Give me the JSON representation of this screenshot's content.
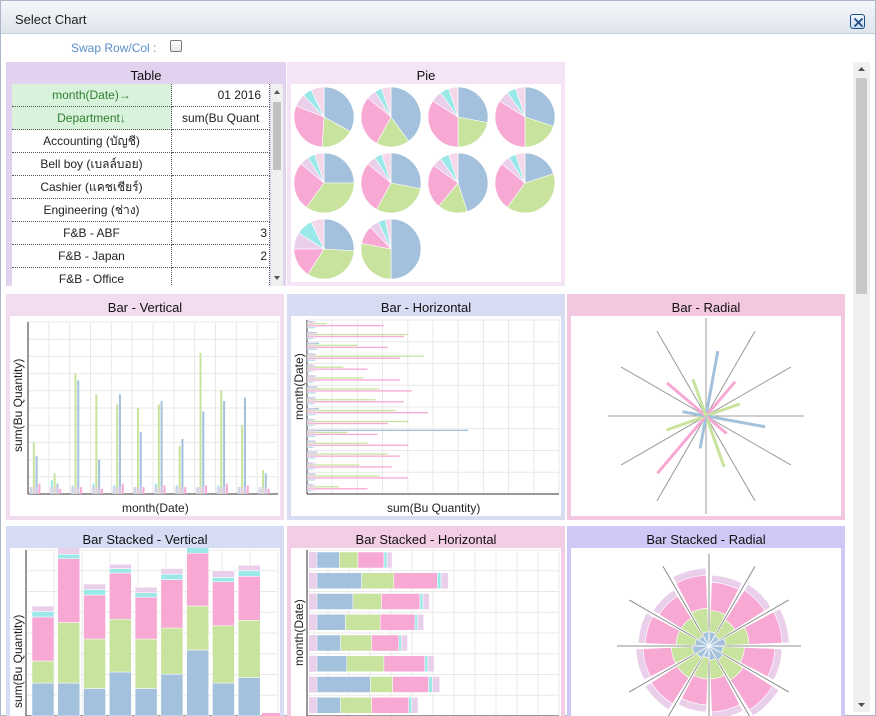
{
  "dialog": {
    "title": "Select Chart",
    "close_icon": "close-icon",
    "swap_label": "Swap Row/Col :",
    "swap_checked": false
  },
  "table_panel": {
    "title": "Table",
    "dim_col_header": "month(Date)→",
    "dim_row_header": "Department↓",
    "col_value": "01 2016",
    "measure_header": "sum(Bu Quant",
    "rows": [
      {
        "label": "Accounting (บัญชี)",
        "value": ""
      },
      {
        "label": "Bell boy (เบลล์บอย)",
        "value": ""
      },
      {
        "label": "Cashier (แคชเชียร์)",
        "value": ""
      },
      {
        "label": "Engineering (ช่าง)",
        "value": ""
      },
      {
        "label": "F&B - ABF",
        "value": "3"
      },
      {
        "label": "F&B - Japan",
        "value": "2"
      },
      {
        "label": "F&B - Office",
        "value": ""
      }
    ]
  },
  "pie_panel": {
    "title": "Pie",
    "pie_slices": [
      [
        0.33,
        0.18,
        0.3,
        0.07,
        0.05,
        0.07
      ],
      [
        0.4,
        0.18,
        0.28,
        0.05,
        0.04,
        0.05
      ],
      [
        0.28,
        0.22,
        0.34,
        0.06,
        0.05,
        0.05
      ],
      [
        0.3,
        0.2,
        0.34,
        0.06,
        0.05,
        0.05
      ],
      [
        0.25,
        0.35,
        0.26,
        0.05,
        0.04,
        0.05
      ],
      [
        0.28,
        0.3,
        0.28,
        0.05,
        0.04,
        0.05
      ],
      [
        0.45,
        0.16,
        0.24,
        0.05,
        0.05,
        0.05
      ],
      [
        0.2,
        0.4,
        0.26,
        0.05,
        0.04,
        0.05
      ],
      [
        0.26,
        0.33,
        0.16,
        0.09,
        0.09,
        0.07
      ],
      [
        0.5,
        0.28,
        0.1,
        0.05,
        0.04,
        0.03
      ]
    ]
  },
  "colors": {
    "series": [
      "#a3c1dd",
      "#c8e39d",
      "#f7a8d3",
      "#eacfea",
      "#9be8e8",
      "#f5d7ea"
    ],
    "panel_bar_vertical": "#f2dcf0",
    "panel_bar_horizontal": "#d7dcf2",
    "panel_bar_radial": "#f3c7e0",
    "panel_stacked_vertical": "#d6dcf4",
    "panel_stacked_horizontal": "#f3cde6",
    "panel_stacked_radial": "#cdc8f5"
  },
  "panels": {
    "bar_vertical": {
      "title": "Bar - Vertical",
      "x_label": "month(Date)",
      "y_label": "sum(Bu Quantity)"
    },
    "bar_horizontal": {
      "title": "Bar - Horizontal",
      "x_label": "sum(Bu Quantity)",
      "y_label": "month(Date)"
    },
    "bar_radial": {
      "title": "Bar - Radial"
    },
    "stacked_vertical": {
      "title": "Bar Stacked - Vertical",
      "y_label": "sum(Bu Quantity)"
    },
    "stacked_horizontal": {
      "title": "Bar Stacked - Horizontal",
      "y_label": "month(Date)"
    },
    "stacked_radial": {
      "title": "Bar Stacked - Radial"
    }
  },
  "chart_data": [
    {
      "type": "pie",
      "title": "Pie"
    },
    {
      "type": "bar",
      "title": "Bar - Vertical",
      "xlabel": "month(Date)",
      "ylabel": "sum(Bu Quantity)",
      "group_values": [
        [
          4,
          30,
          22,
          6
        ],
        [
          8,
          12,
          6,
          3
        ],
        [
          5,
          70,
          66,
          4
        ],
        [
          6,
          58,
          20,
          3
        ],
        [
          5,
          52,
          58,
          6
        ],
        [
          4,
          50,
          36,
          4
        ],
        [
          6,
          52,
          54,
          5
        ],
        [
          5,
          28,
          32,
          4
        ],
        [
          4,
          82,
          48,
          5
        ],
        [
          5,
          60,
          54,
          6
        ],
        [
          4,
          40,
          56,
          5
        ],
        [
          3,
          14,
          12,
          3
        ]
      ]
    },
    {
      "type": "bar",
      "title": "Bar - Horizontal",
      "xlabel": "sum(Bu Quantity)",
      "ylabel": "month(Date)",
      "group_values": [
        [
          3,
          10,
          38,
          4
        ],
        [
          5,
          50,
          48,
          3
        ],
        [
          6,
          25,
          40,
          5
        ],
        [
          4,
          58,
          46,
          4
        ],
        [
          3,
          18,
          30,
          2
        ],
        [
          4,
          28,
          46,
          3
        ],
        [
          5,
          36,
          52,
          4
        ],
        [
          4,
          34,
          48,
          3
        ],
        [
          6,
          44,
          60,
          4
        ],
        [
          3,
          50,
          40,
          3
        ],
        [
          80,
          20,
          35,
          4
        ],
        [
          4,
          30,
          50,
          3
        ],
        [
          5,
          40,
          46,
          4
        ],
        [
          3,
          26,
          42,
          3
        ],
        [
          4,
          36,
          50,
          4
        ],
        [
          3,
          16,
          30,
          2
        ]
      ]
    },
    {
      "type": "bar",
      "title": "Bar - Radial",
      "spokes": [
        [
          44,
          "#a3c1dd"
        ],
        [
          30,
          "#f7a8d3"
        ],
        [
          24,
          "#c8e39d"
        ],
        [
          40,
          "#a3c1dd"
        ],
        [
          18,
          "#f7a8d3"
        ],
        [
          36,
          "#c8e39d"
        ],
        [
          22,
          "#a3c1dd"
        ],
        [
          50,
          "#f7a8d3"
        ],
        [
          28,
          "#c8e39d"
        ],
        [
          16,
          "#a3c1dd"
        ],
        [
          34,
          "#f7a8d3"
        ],
        [
          26,
          "#c8e39d"
        ]
      ]
    },
    {
      "type": "bar",
      "title": "Bar Stacked - Vertical",
      "ylabel": "sum(Bu Quantity)",
      "stacks": [
        [
          30,
          20,
          40,
          5,
          5
        ],
        [
          30,
          55,
          58,
          4,
          6
        ],
        [
          25,
          45,
          40,
          5,
          5
        ],
        [
          40,
          48,
          42,
          4,
          4
        ],
        [
          25,
          45,
          38,
          4,
          5
        ],
        [
          38,
          42,
          44,
          5,
          5
        ],
        [
          60,
          40,
          48,
          5,
          5
        ],
        [
          30,
          52,
          40,
          4,
          6
        ],
        [
          35,
          52,
          40,
          5,
          5
        ]
      ]
    },
    {
      "type": "bar",
      "title": "Bar Stacked - Horizontal",
      "ylabel": "month(Date)",
      "stacks": [
        [
          36,
          30,
          42,
          5,
          8
        ],
        [
          72,
          52,
          70,
          6,
          12
        ],
        [
          58,
          46,
          62,
          5,
          10
        ],
        [
          46,
          56,
          56,
          4,
          10
        ],
        [
          38,
          50,
          44,
          4,
          10
        ],
        [
          48,
          60,
          66,
          5,
          10
        ],
        [
          86,
          36,
          58,
          6,
          12
        ],
        [
          38,
          50,
          60,
          5,
          10
        ]
      ]
    },
    {
      "type": "bar",
      "title": "Bar Stacked - Radial",
      "wedges": [
        [
          12,
          18,
          24,
          6
        ],
        [
          10,
          16,
          30,
          6
        ],
        [
          14,
          20,
          28,
          6
        ],
        [
          12,
          18,
          26,
          6
        ],
        [
          14,
          20,
          30,
          6
        ],
        [
          12,
          16,
          28,
          6
        ],
        [
          10,
          18,
          22,
          6
        ],
        [
          12,
          20,
          26,
          6
        ],
        [
          14,
          18,
          24,
          6
        ],
        [
          12,
          16,
          26,
          6
        ],
        [
          10,
          18,
          22,
          6
        ],
        [
          12,
          20,
          28,
          6
        ]
      ]
    }
  ]
}
